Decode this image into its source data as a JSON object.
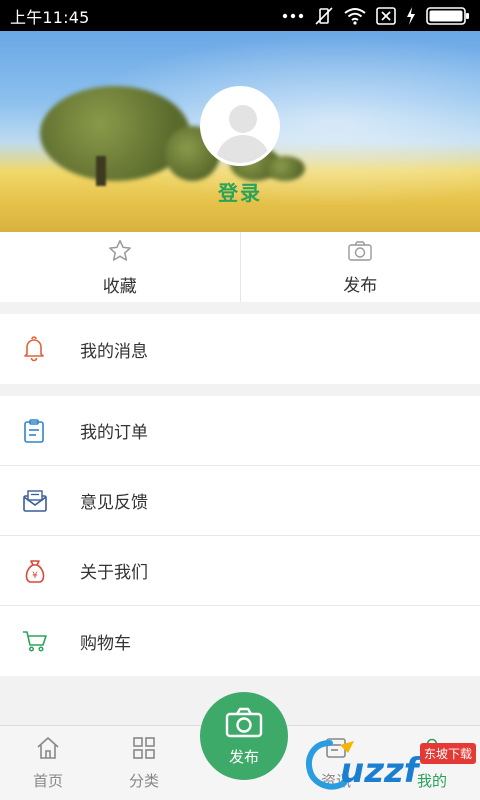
{
  "status_bar": {
    "time": "上午11:45"
  },
  "header": {
    "login_label": "登录"
  },
  "quick_actions": [
    {
      "label": "收藏",
      "icon": "star-icon"
    },
    {
      "label": "发布",
      "icon": "camera-icon"
    }
  ],
  "menu": {
    "group1": [
      {
        "label": "我的消息",
        "icon": "bell-icon",
        "color": "#e2623b"
      }
    ],
    "group2": [
      {
        "label": "我的订单",
        "icon": "clipboard-icon",
        "color": "#2f86c7"
      },
      {
        "label": "意见反馈",
        "icon": "envelope-icon",
        "color": "#3a5d9a"
      },
      {
        "label": "关于我们",
        "icon": "money-bag-icon",
        "color": "#d9473a"
      },
      {
        "label": "购物车",
        "icon": "cart-icon",
        "color": "#2aa35a"
      }
    ]
  },
  "bottom_nav": {
    "items": [
      {
        "label": "首页",
        "icon": "home-icon"
      },
      {
        "label": "分类",
        "icon": "grid-icon"
      },
      {
        "label": "资讯",
        "icon": "news-icon"
      },
      {
        "label": "我的",
        "icon": "user-icon"
      }
    ],
    "publish_label": "发布"
  },
  "watermark": {
    "logo_text": "uzzf",
    "badge": "东坡下载"
  },
  "colors": {
    "accent": "#2aa35a",
    "fab": "#3eaa69"
  }
}
